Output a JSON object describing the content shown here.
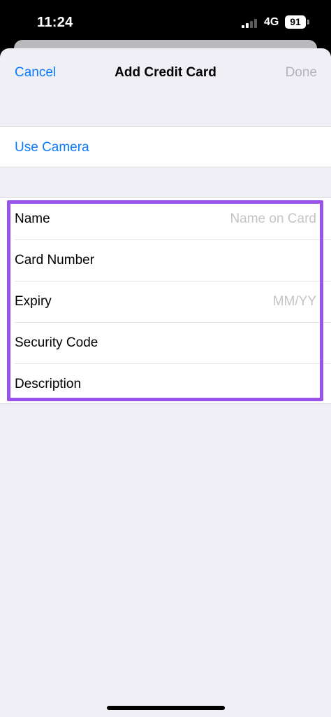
{
  "status_bar": {
    "time": "11:24",
    "network": "4G",
    "battery": "91"
  },
  "nav": {
    "cancel": "Cancel",
    "title": "Add Credit Card",
    "done": "Done"
  },
  "camera": {
    "label": "Use Camera"
  },
  "form": {
    "rows": [
      {
        "label": "Name",
        "placeholder": "Name on Card"
      },
      {
        "label": "Card Number",
        "placeholder": ""
      },
      {
        "label": "Expiry",
        "placeholder": "MM/YY"
      },
      {
        "label": "Security Code",
        "placeholder": ""
      },
      {
        "label": "Description",
        "placeholder": ""
      }
    ]
  },
  "colors": {
    "accent": "#0a7aff",
    "highlight": "#9a53e8",
    "background": "#f0eff5"
  }
}
